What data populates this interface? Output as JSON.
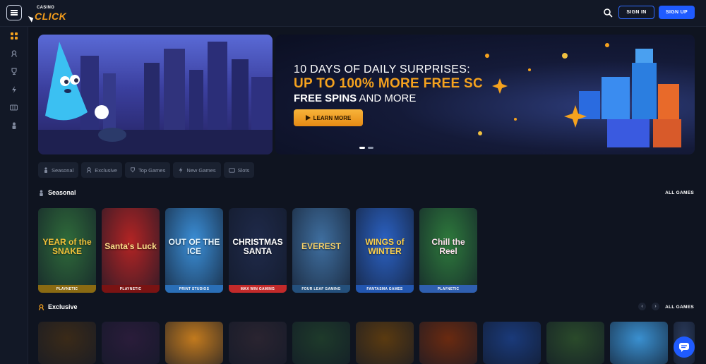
{
  "header": {
    "logo_small": "CASINO",
    "logo_big": "CLICK",
    "sign_in": "SIGN IN",
    "sign_up": "SIGN UP"
  },
  "sidebar": {
    "items": [
      {
        "icon": "grid-icon",
        "active": true
      },
      {
        "icon": "exclusive-icon"
      },
      {
        "icon": "trophy-icon"
      },
      {
        "icon": "lightning-icon"
      },
      {
        "icon": "slots-icon"
      },
      {
        "icon": "seasonal-icon"
      }
    ]
  },
  "hero": {
    "line1": "10 DAYS OF DAILY SURPRISES:",
    "line2": "UP TO 100% MORE FREE SC",
    "line3_bold": "FREE SPINS",
    "line3_rest": " AND MORE",
    "cta": "LEARN MORE"
  },
  "filters": [
    {
      "label": "Seasonal",
      "icon": "seasonal-icon"
    },
    {
      "label": "Exclusive",
      "icon": "exclusive-icon"
    },
    {
      "label": "Top Games",
      "icon": "trophy-icon"
    },
    {
      "label": "New Games",
      "icon": "lightning-icon"
    },
    {
      "label": "Slots",
      "icon": "slots-icon"
    }
  ],
  "seasonal": {
    "title": "Seasonal",
    "all_games": "ALL GAMES",
    "games": [
      {
        "name": "YEAR of the SNAKE",
        "studio": "PLAYNETIC",
        "bg": "#2f6b3a",
        "bar": "#8a6a12",
        "text": "#f2c23a"
      },
      {
        "name": "Santa's Luck",
        "studio": "PLAYNETIC",
        "bg": "#b32424",
        "bar": "#7a1313",
        "text": "#ffe08a"
      },
      {
        "name": "OUT OF THE ICE",
        "studio": "PRINT STUDIOS",
        "bg": "#3b8fd8",
        "bar": "#2a6fb8",
        "text": "#e9f7ff"
      },
      {
        "name": "CHRISTMAS SANTA",
        "studio": "MAX WIN GAMING",
        "bg": "#1f2a4a",
        "bar": "#c22a2a",
        "text": "#ffffff"
      },
      {
        "name": "EVEREST",
        "studio": "FOUR LEAF GAMING",
        "bg": "#3f6fa0",
        "bar": "#24507c",
        "text": "#f4d06a"
      },
      {
        "name": "WINGS of WINTER",
        "studio": "FANTASMA GAMES",
        "bg": "#2b62c4",
        "bar": "#2256b0",
        "text": "#ffd24a"
      },
      {
        "name": "Chill the Reel",
        "studio": "PLAYNETIC",
        "bg": "#2e7a3c",
        "bar": "#2f5fb0",
        "text": "#ffe3f0"
      }
    ]
  },
  "exclusive": {
    "title": "Exclusive",
    "all_games": "ALL GAMES",
    "prev": "‹",
    "next": "›",
    "games": [
      {
        "bg": "#3a2a18"
      },
      {
        "bg": "#2a1c3a"
      },
      {
        "bg": "#c27a1e"
      },
      {
        "bg": "#2a2430"
      },
      {
        "bg": "#1e3a2a"
      },
      {
        "bg": "#5a3a10"
      },
      {
        "bg": "#6a2a10"
      },
      {
        "bg": "#1a3a7a"
      },
      {
        "bg": "#2a4a2a"
      },
      {
        "bg": "#3a90d0"
      },
      {
        "bg": "#2a3a5a"
      }
    ]
  }
}
